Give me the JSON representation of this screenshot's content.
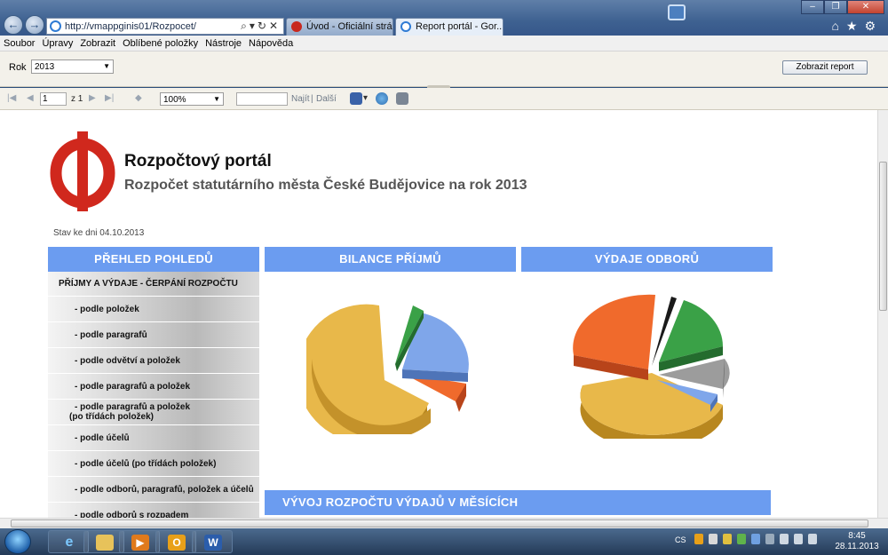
{
  "browser": {
    "url": "http://vmappginis01/Rozpocet/",
    "tabs": [
      {
        "label": "Úvod - Oficiální stránky..."
      },
      {
        "label": "Report portál - Gor..."
      }
    ]
  },
  "menu": [
    "Soubor",
    "Úpravy",
    "Zobrazit",
    "Oblíbené položky",
    "Nástroje",
    "Nápověda"
  ],
  "params": {
    "year_label": "Rok",
    "year_value": "2013",
    "view_report_button": "Zobrazit report"
  },
  "toolbar": {
    "page_value": "1",
    "page_of": "z 1",
    "zoom_value": "100%",
    "find_label": "Najít",
    "separator": "|",
    "next_label": "Další"
  },
  "report": {
    "title": "Rozpočtový portál",
    "subtitle": "Rozpočet statutárního města České Budějovice na rok 2013",
    "status": "Stav ke dni 04.10.2013",
    "nav_header": "PŘEHLED POHLEDŮ",
    "nav_items": [
      "PŘÍJMY A VÝDAJE - ČERPÁNÍ ROZPOČTU",
      "- podle položek",
      "- podle paragrafů",
      "- podle odvětví a položek",
      "- podle paragrafů a položek",
      "- podle paragrafů a položek",
      "(po třídách položek)",
      "- podle účelů",
      "- podle účelů (po třídách položek)",
      "- podle odborů, paragrafů, položek a účelů",
      "- podle odborů s rozpadem"
    ],
    "chart_left_title": "BILANCE PŘÍJMŮ",
    "chart_right_title": "VÝDAJE ODBORŮ",
    "bottom_title": "VÝVOJ ROZPOČTU VÝDAJŮ V MĚSÍCÍCH"
  },
  "taskbar": {
    "language": "CS",
    "time": "8:45",
    "date": "28.11.2013"
  },
  "colors": {
    "header_blue": "#6b9cf0",
    "pie_gold": "#e8b84a",
    "pie_blue": "#7fa6ea",
    "pie_red": "#f06a2c",
    "pie_green": "#3aa147",
    "pie_gray": "#9c9c9c",
    "pie_black": "#1a1a1a"
  }
}
